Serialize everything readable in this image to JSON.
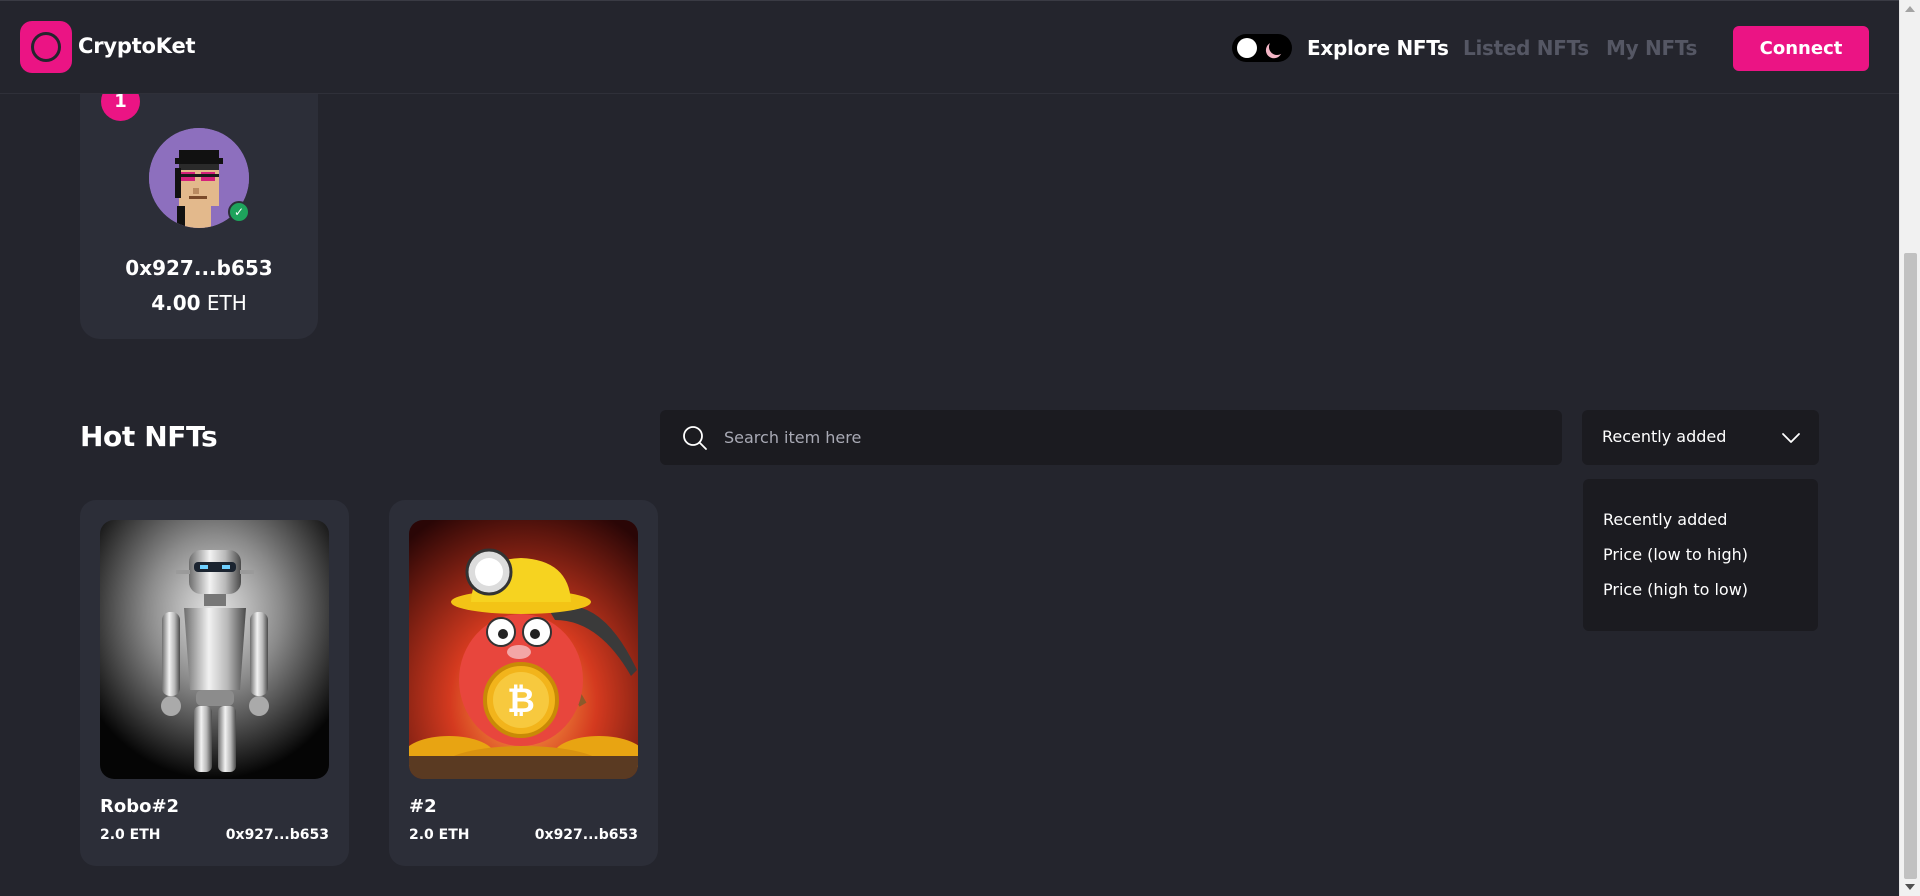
{
  "navbar": {
    "brand": "CryptoKet",
    "links": [
      {
        "label": "Explore NFTs",
        "active": true
      },
      {
        "label": "Listed NFTs",
        "active": false
      },
      {
        "label": "My NFTs",
        "active": false
      }
    ],
    "connect_label": "Connect",
    "theme_toggle_icon": "moon-icon",
    "accent_color": "#eb1484"
  },
  "creator": {
    "rank": "1",
    "address": "0x927...b653",
    "balance_amount": "4.00",
    "balance_currency": "ETH"
  },
  "hot_nfts": {
    "title": "Hot NFTs",
    "search_placeholder": "Search item here",
    "sort_selected": "Recently added",
    "sort_options": [
      "Recently added",
      "Price (low to high)",
      "Price (high to low)"
    ],
    "items": [
      {
        "name": "Robo#2",
        "price": "2.0 ETH",
        "owner": "0x927...b653"
      },
      {
        "name": "#2",
        "price": "2.0 ETH",
        "owner": "0x927...b653"
      }
    ]
  }
}
